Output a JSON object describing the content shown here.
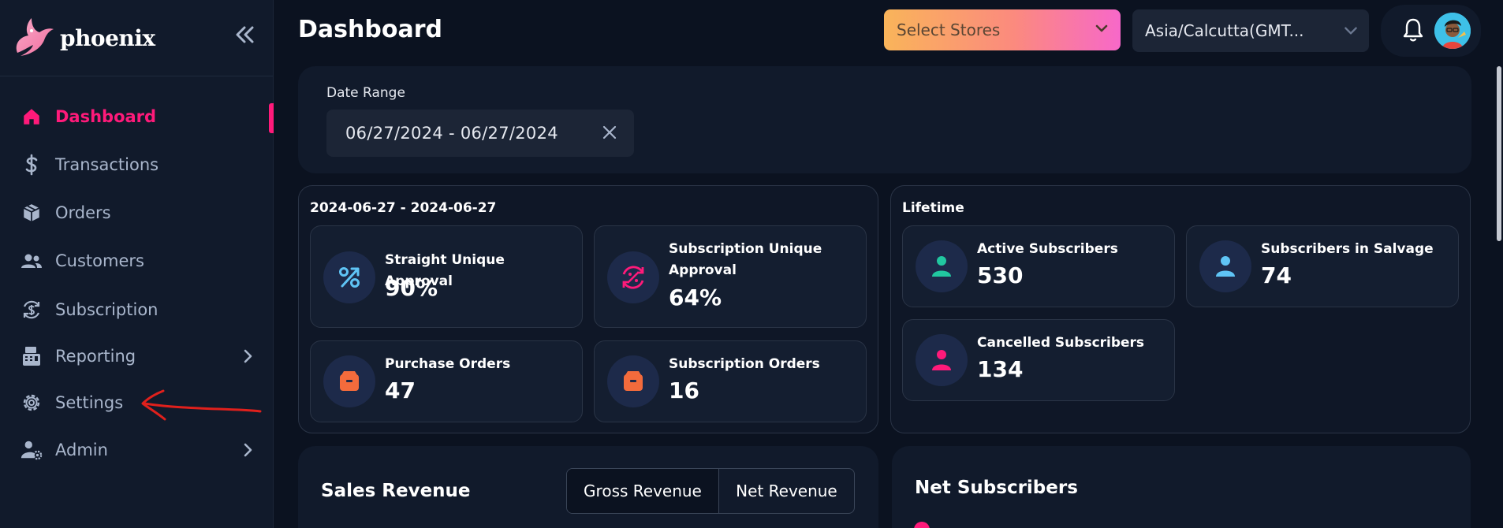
{
  "app": {
    "brand_name": "phoenix"
  },
  "sidebar": {
    "items": [
      {
        "label": "Dashboard",
        "active": true
      },
      {
        "label": "Transactions"
      },
      {
        "label": "Orders"
      },
      {
        "label": "Customers"
      },
      {
        "label": "Subscription"
      },
      {
        "label": "Reporting",
        "has_submenu": true
      },
      {
        "label": "Settings"
      },
      {
        "label": "Admin",
        "has_submenu": true
      }
    ]
  },
  "header": {
    "title": "Dashboard",
    "store_select": {
      "placeholder": "Select Stores"
    },
    "timezone_select": {
      "value": "Asia/Calcutta(GMT..."
    }
  },
  "date_range": {
    "label": "Date Range",
    "value": "06/27/2024 - 06/27/2024"
  },
  "period_stats": {
    "title": "2024-06-27 - 2024-06-27",
    "cards": [
      {
        "label": "Straight Unique Approval",
        "value": "90%",
        "icon": "percent-icon"
      },
      {
        "label": "Subscription Unique Approval",
        "value": "64%",
        "icon": "recurring-percent-icon"
      },
      {
        "label": "Purchase Orders",
        "value": "47",
        "icon": "box-icon"
      },
      {
        "label": "Subscription Orders",
        "value": "16",
        "icon": "box-icon"
      }
    ]
  },
  "lifetime_stats": {
    "title": "Lifetime",
    "cards": [
      {
        "label": "Active Subscribers",
        "value": "530",
        "icon": "user-icon"
      },
      {
        "label": "Subscribers in Salvage",
        "value": "74",
        "icon": "user-icon"
      },
      {
        "label": "Cancelled Subscribers",
        "value": "134",
        "icon": "user-icon"
      }
    ]
  },
  "sales_revenue": {
    "title": "Sales Revenue",
    "tabs": [
      {
        "label": "Gross Revenue",
        "active": true
      },
      {
        "label": "Net Revenue"
      }
    ]
  },
  "net_subscribers": {
    "title": "Net Subscribers"
  },
  "colors": {
    "accent": "#ff1a7a",
    "sidebar_bg": "#111a2b",
    "page_bg": "#0b1220",
    "active_user_icon": "#21c7a0",
    "salvage_user_icon": "#5fc4f5",
    "cancelled_user_icon": "#ff1a7a",
    "box_icon": "#f36b3c"
  }
}
